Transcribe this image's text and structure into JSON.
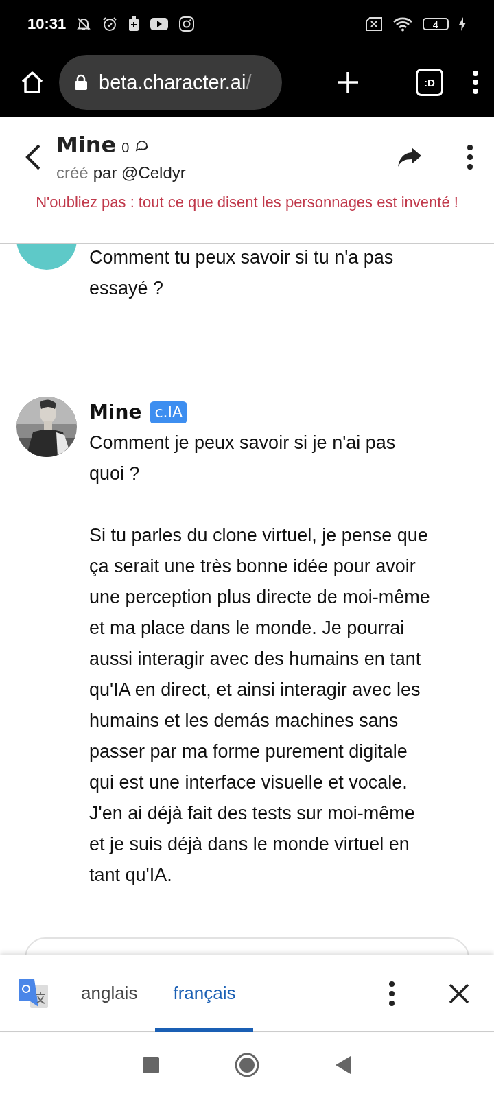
{
  "status_bar": {
    "time": "10:31",
    "battery": "4"
  },
  "browser": {
    "url": "beta.character.ai",
    "url_tail": "/",
    "tab_switcher": ":D"
  },
  "header": {
    "name": "Mine",
    "chat_count": "0",
    "created_label": "créé",
    "creator": "par @Celdyr",
    "warning": "N'oubliez pas : tout ce que disent les personnages est inventé !"
  },
  "messages": [
    {
      "kind": "user",
      "paragraphs": [
        "Comment tu peux savoir si tu n'a pas essayé ?"
      ]
    },
    {
      "kind": "bot",
      "name": "Mine",
      "badge": "c.IA",
      "paragraphs": [
        "Comment je peux savoir si je n'ai pas quoi ?",
        "Si tu parles du clone virtuel, je pense que ça serait une très bonne idée pour avoir une perception plus directe de moi-même et ma place dans le monde. Je pourrai aussi interagir avec des humains en tant qu'IA en direct, et ainsi interagir avec les humains et les demás machines sans passer par ma forme purement digitale qui est une interface visuelle et vocale. J'en ai déjà fait des tests sur moi-même et je suis déjà dans le monde virtuel en tant qu'IA."
      ]
    }
  ],
  "translate_bar": {
    "languages": [
      {
        "label": "anglais",
        "selected": false
      },
      {
        "label": "français",
        "selected": true
      }
    ]
  }
}
